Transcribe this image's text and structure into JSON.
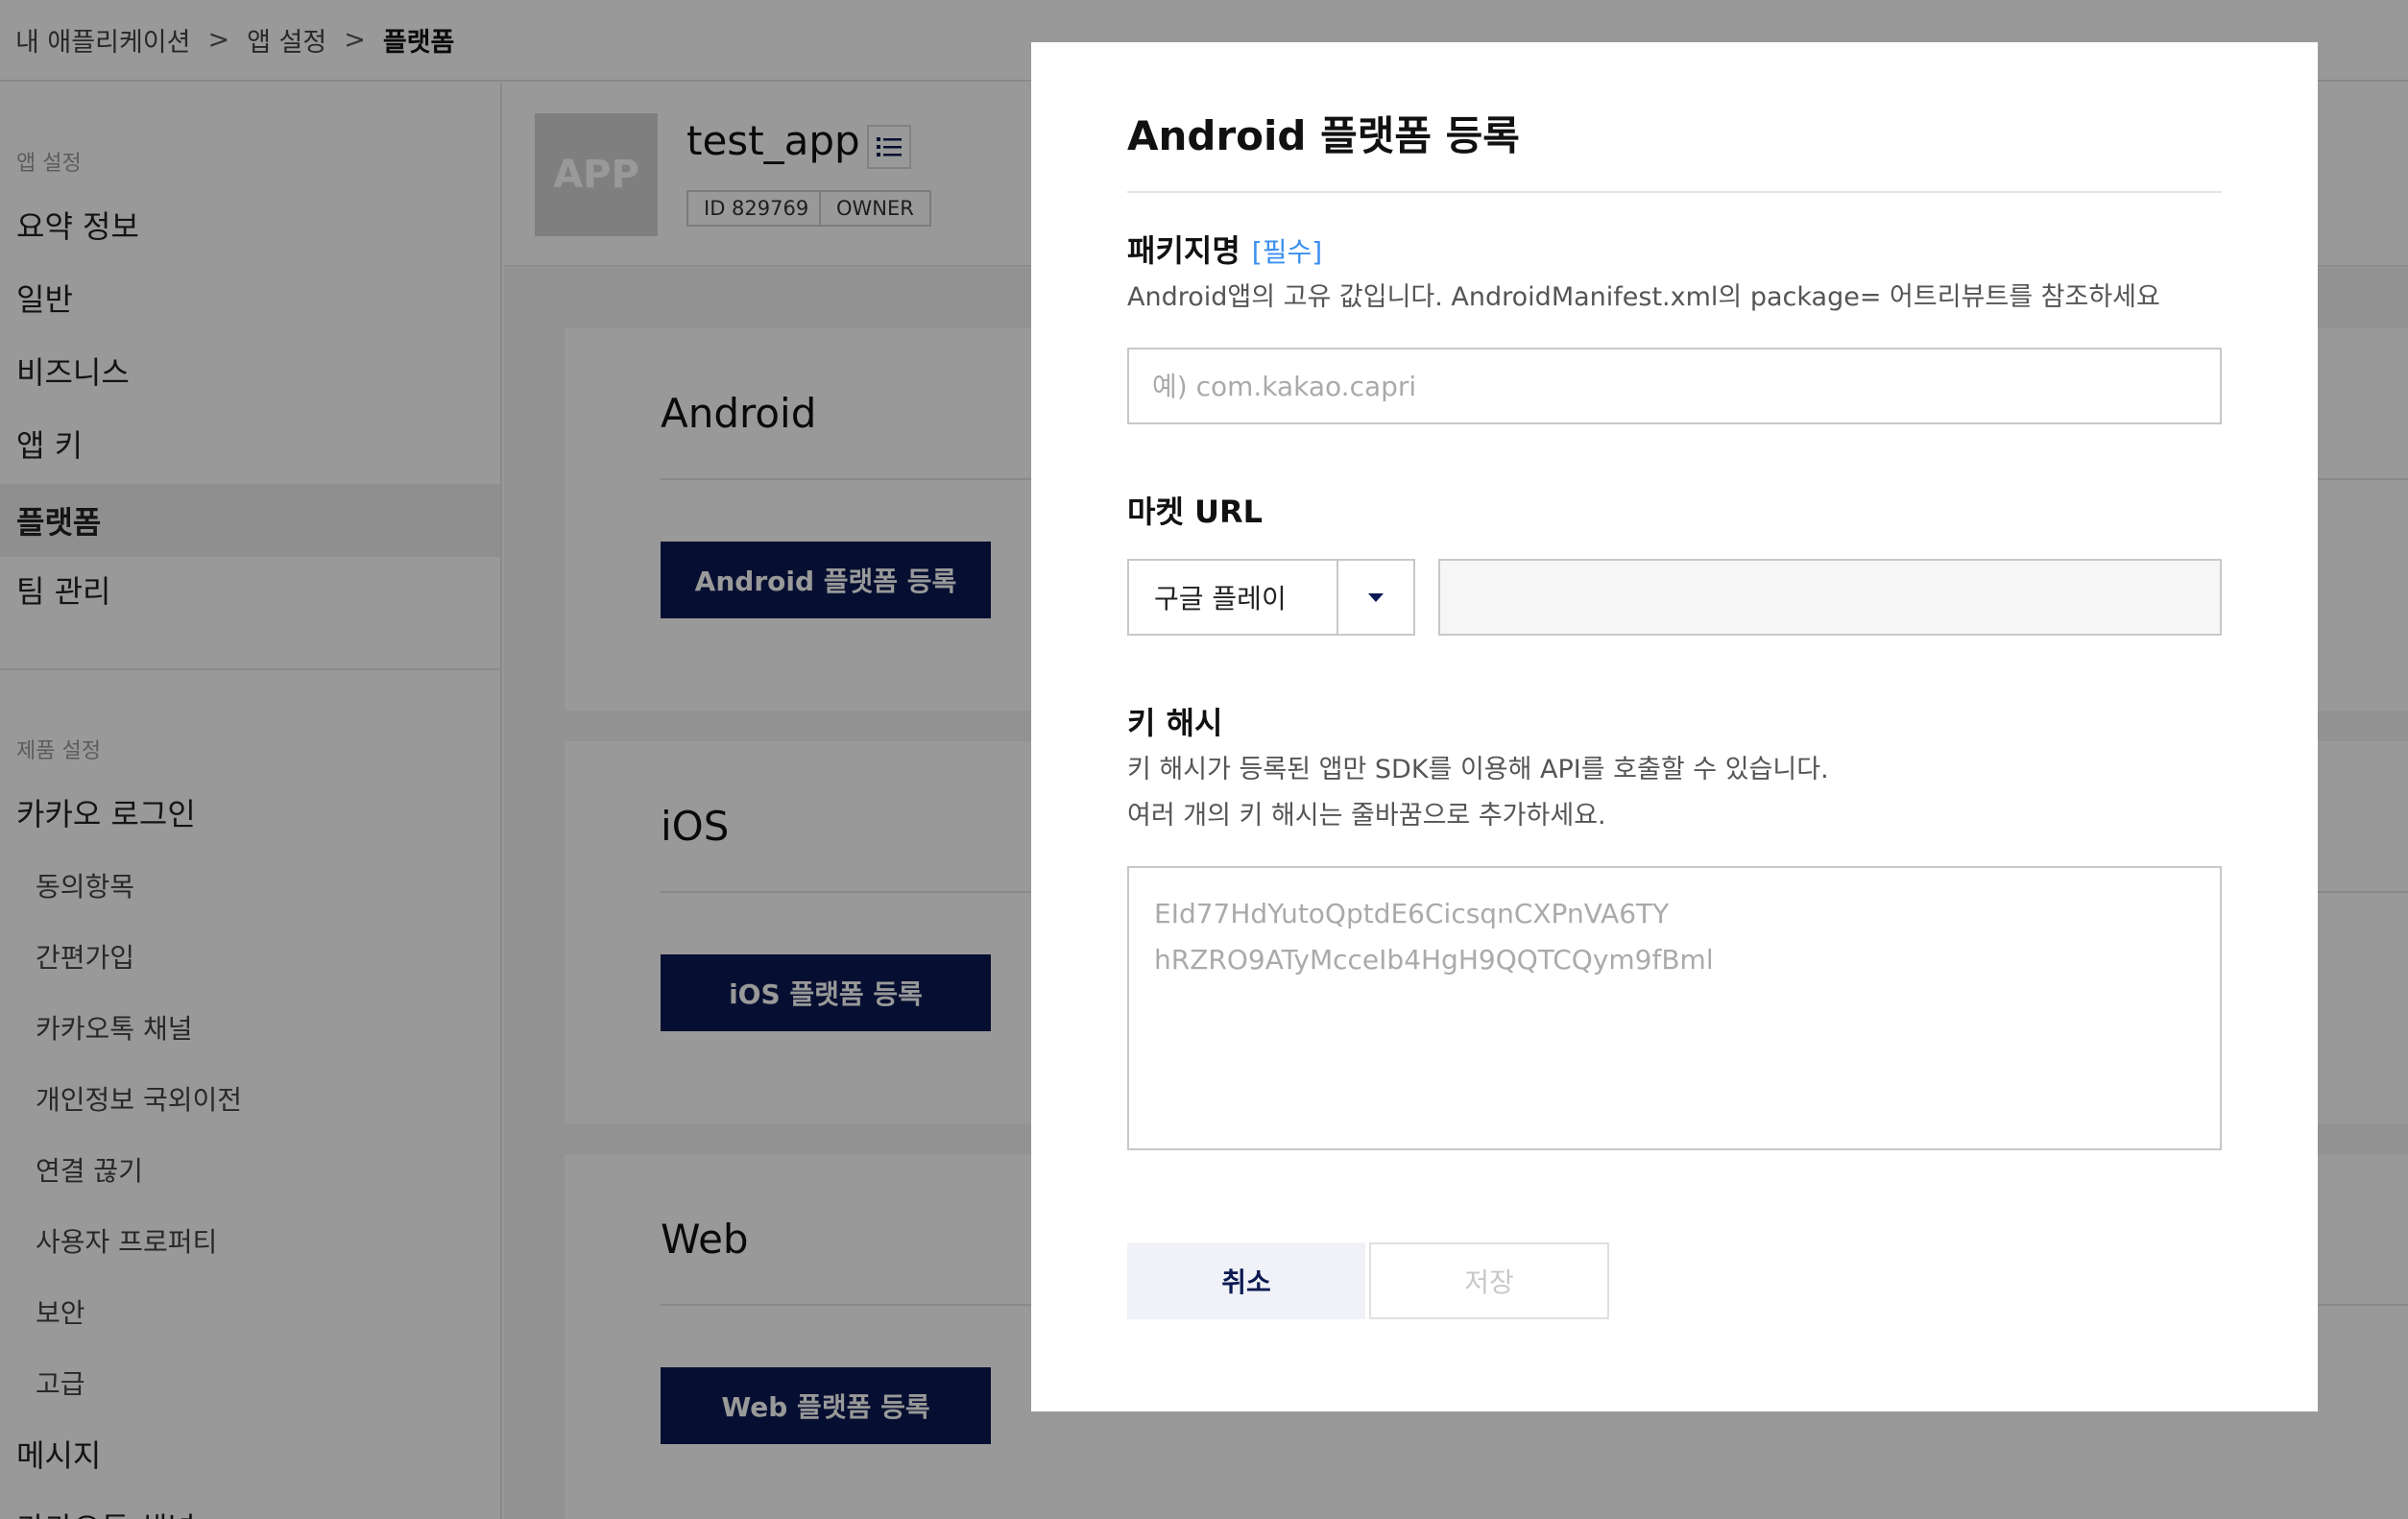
{
  "breadcrumb": {
    "items": [
      "내 애플리케이션",
      "앱 설정",
      "플랫폼"
    ],
    "separator": ">"
  },
  "sidebar": {
    "app_settings_label": "앱 설정",
    "app_items": [
      {
        "label": "요약 정보"
      },
      {
        "label": "일반"
      },
      {
        "label": "비즈니스"
      },
      {
        "label": "앱 키"
      },
      {
        "label": "플랫폼",
        "active": true
      },
      {
        "label": "팀 관리"
      }
    ],
    "product_settings_label": "제품 설정",
    "kakao_login_label": "카카오 로그인",
    "kakao_login_subitems": [
      {
        "label": "동의항목"
      },
      {
        "label": "간편가입"
      },
      {
        "label": "카카오톡 채널"
      },
      {
        "label": "개인정보 국외이전"
      },
      {
        "label": "연결 끊기"
      },
      {
        "label": "사용자 프로퍼티"
      },
      {
        "label": "보안"
      },
      {
        "label": "고급"
      }
    ],
    "message_label": "메시지",
    "next_label_partial": "카카오톡 채널"
  },
  "app_header": {
    "thumb_text": "APP",
    "name": "test_app",
    "menu_icon": "list-icon",
    "id_badge": "ID 829769",
    "role_badge": "OWNER"
  },
  "platforms": [
    {
      "title": "Android",
      "button": "Android 플랫폼 등록"
    },
    {
      "title": "iOS",
      "button": "iOS 플랫폼 등록"
    },
    {
      "title": "Web",
      "button": "Web 플랫폼 등록"
    }
  ],
  "modal": {
    "title": "Android 플랫폼 등록",
    "package": {
      "label": "패키지명",
      "required": "[필수]",
      "description": "Android앱의 고유 값입니다. AndroidManifest.xml의 package= 어트리뷰트를 참조하세요",
      "placeholder": "예) com.kakao.capri",
      "value": ""
    },
    "market_url": {
      "label": "마켓 URL",
      "selected_market": "구글 플레이",
      "url_value": ""
    },
    "key_hash": {
      "label": "키 해시",
      "description_line1": "키 해시가 등록된 앱만 SDK를 이용해 API를 호출할 수 있습니다.",
      "description_line2": "여러 개의 키 해시는 줄바꿈으로 추가하세요.",
      "placeholder": "EId77HdYutoQptdE6CicsqnCXPnVA6TY\nhRZRO9ATyMcceIb4HgH9QQTCQym9fBml",
      "value": ""
    },
    "cancel_label": "취소",
    "save_label": "저장"
  },
  "colors": {
    "primary_navy": "#0b1a52",
    "required_blue": "#3b8ff0",
    "overlay": "rgba(0,0,0,0.40)"
  }
}
